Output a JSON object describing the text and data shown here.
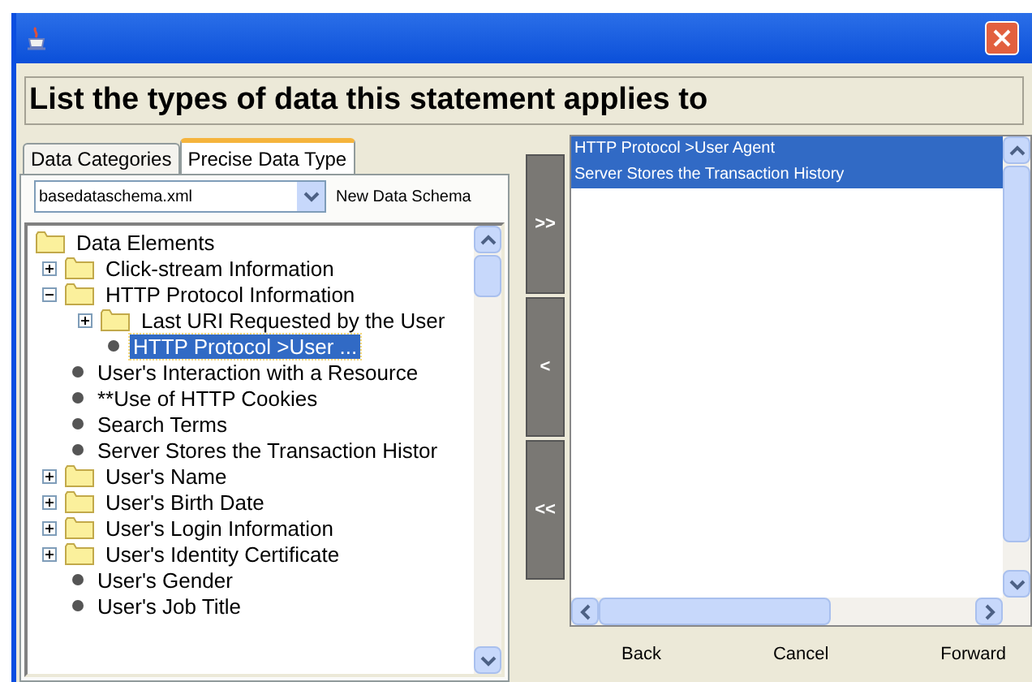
{
  "header": {
    "title": "List the types of data this statement applies to"
  },
  "tabs": [
    {
      "label": "Data Categories",
      "selected": false
    },
    {
      "label": "Precise Data Type",
      "selected": true
    }
  ],
  "schema": {
    "value": "basedataschema.xml",
    "new_button": "New Data Schema"
  },
  "tree": [
    {
      "label": "Data Elements",
      "kind": "folder",
      "selected": false,
      "children": [
        {
          "label": "Click-stream Information",
          "kind": "folder",
          "expanded": false,
          "selected": false
        },
        {
          "label": "HTTP Protocol Information",
          "kind": "folder",
          "expanded": true,
          "selected": false,
          "children": [
            {
              "label": "Last URI Requested by the User",
              "kind": "folder",
              "expanded": false,
              "selected": false
            },
            {
              "label": "HTTP Protocol >User ...",
              "kind": "leaf",
              "selected": true
            }
          ]
        },
        {
          "label": "User's Interaction with a Resource",
          "kind": "leaf",
          "selected": false
        },
        {
          "label": "**Use of HTTP Cookies",
          "kind": "leaf",
          "selected": false
        },
        {
          "label": "Search Terms",
          "kind": "leaf",
          "selected": false
        },
        {
          "label": "Server Stores the Transaction Histor",
          "kind": "leaf",
          "selected": false
        },
        {
          "label": "User's Name",
          "kind": "folder",
          "expanded": false,
          "selected": false
        },
        {
          "label": "User's Birth Date",
          "kind": "folder",
          "expanded": false,
          "selected": false
        },
        {
          "label": "User's Login Information",
          "kind": "folder",
          "expanded": false,
          "selected": false
        },
        {
          "label": "User's Identity Certificate",
          "kind": "folder",
          "expanded": false,
          "selected": false
        },
        {
          "label": "User's Gender",
          "kind": "leaf",
          "selected": false
        },
        {
          "label": "User's Job Title",
          "kind": "leaf",
          "selected": false
        }
      ]
    }
  ],
  "transfer_buttons": [
    ">>",
    "<",
    "<<"
  ],
  "selected_types": [
    {
      "label": "HTTP Protocol >User Agent",
      "selected": true
    },
    {
      "label": "Server Stores the Transaction History",
      "selected": true
    }
  ],
  "nav_buttons": [
    "Back",
    "Cancel",
    "Forward"
  ]
}
